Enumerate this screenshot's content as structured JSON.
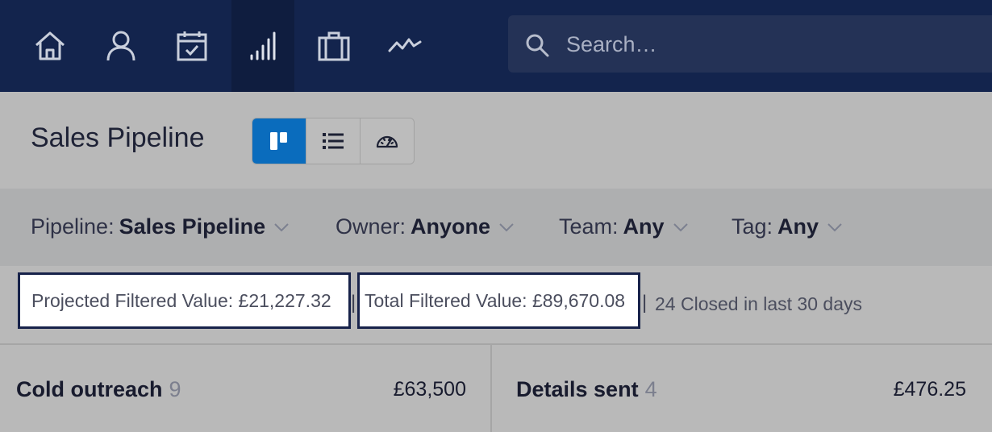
{
  "nav": {
    "items": [
      {
        "icon": "home-icon"
      },
      {
        "icon": "person-icon"
      },
      {
        "icon": "calendar-check-icon"
      },
      {
        "icon": "signal-bars-icon",
        "active": true
      },
      {
        "icon": "briefcase-icon"
      },
      {
        "icon": "activity-line-icon"
      }
    ]
  },
  "search": {
    "placeholder": "Search…",
    "value": ""
  },
  "header": {
    "title": "Sales Pipeline",
    "views": [
      {
        "icon": "board-view-icon",
        "active": true
      },
      {
        "icon": "list-view-icon",
        "active": false
      },
      {
        "icon": "dashboard-gauge-icon",
        "active": false
      }
    ]
  },
  "filters": {
    "pipeline": {
      "label": "Pipeline:",
      "value": "Sales Pipeline"
    },
    "owner": {
      "label": "Owner:",
      "value": "Anyone"
    },
    "team": {
      "label": "Team:",
      "value": "Any"
    },
    "tag": {
      "label": "Tag:",
      "value": "Any"
    }
  },
  "stats": {
    "projected": "Projected Filtered Value: £21,227.32",
    "total": "Total Filtered Value: £89,670.08",
    "separator": "|",
    "closed": "24 Closed in last 30 days"
  },
  "columns": [
    {
      "title": "Cold outreach",
      "count": "9",
      "value": "£63,500"
    },
    {
      "title": "Details sent",
      "count": "4",
      "value": "£476.25"
    }
  ],
  "colors": {
    "nav_bg": "#13244d",
    "search_bg": "#243256",
    "accent": "#0a6cbd",
    "stat_border": "#17224a"
  }
}
